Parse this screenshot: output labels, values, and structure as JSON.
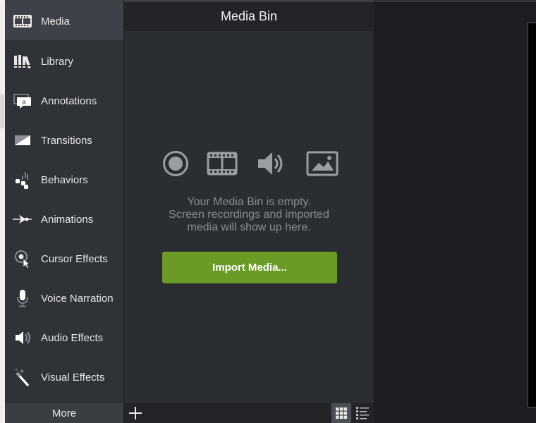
{
  "sidebar": {
    "items": [
      {
        "label": "Media",
        "icon": "film-strip-icon",
        "active": true
      },
      {
        "label": "Library",
        "icon": "library-books-icon",
        "active": false
      },
      {
        "label": "Annotations",
        "icon": "speech-bubble-icon",
        "active": false
      },
      {
        "label": "Transitions",
        "icon": "transition-icon",
        "active": false
      },
      {
        "label": "Behaviors",
        "icon": "behaviors-icon",
        "active": false
      },
      {
        "label": "Animations",
        "icon": "animation-arrow-icon",
        "active": false
      },
      {
        "label": "Cursor Effects",
        "icon": "cursor-effect-icon",
        "active": false
      },
      {
        "label": "Voice Narration",
        "icon": "microphone-icon",
        "active": false
      },
      {
        "label": "Audio Effects",
        "icon": "speaker-icon",
        "active": false
      },
      {
        "label": "Visual Effects",
        "icon": "magic-wand-icon",
        "active": false
      }
    ],
    "more_label": "More"
  },
  "media_bin": {
    "title": "Media Bin",
    "empty_line1": "Your Media Bin is empty.",
    "empty_line2": "Screen recordings and imported",
    "empty_line3": "media will show up here.",
    "import_label": "Import Media...",
    "empty_icons": [
      "record-icon",
      "film-icon",
      "audio-icon",
      "image-icon"
    ]
  },
  "colors": {
    "accent_button": "#6b9a26",
    "sidebar_bg": "#2f3236",
    "bin_bg": "#2a2d31"
  }
}
